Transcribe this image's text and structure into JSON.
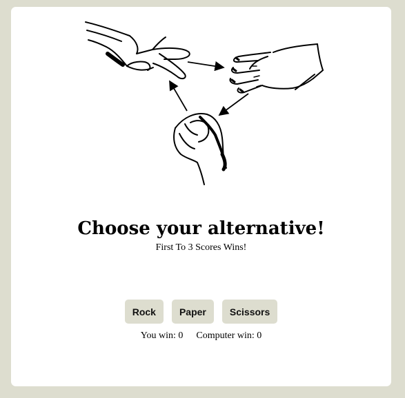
{
  "game": {
    "title": "Choose your alternative!",
    "subtitle": "First To 3 Scores Wins!",
    "choices": [
      {
        "label": "Rock"
      },
      {
        "label": "Paper"
      },
      {
        "label": "Scissors"
      }
    ],
    "score": {
      "you_label": "You win:",
      "you_value": "0",
      "computer_label": "Computer win:",
      "computer_value": "0"
    }
  },
  "icons": [
    "scissors-hand-icon",
    "paper-hand-icon",
    "rock-fist-icon",
    "cycle-arrow-icon"
  ],
  "colors": {
    "background": "#ddddcf",
    "card": "#ffffff",
    "button": "#ddddcf",
    "ink": "#000000"
  }
}
